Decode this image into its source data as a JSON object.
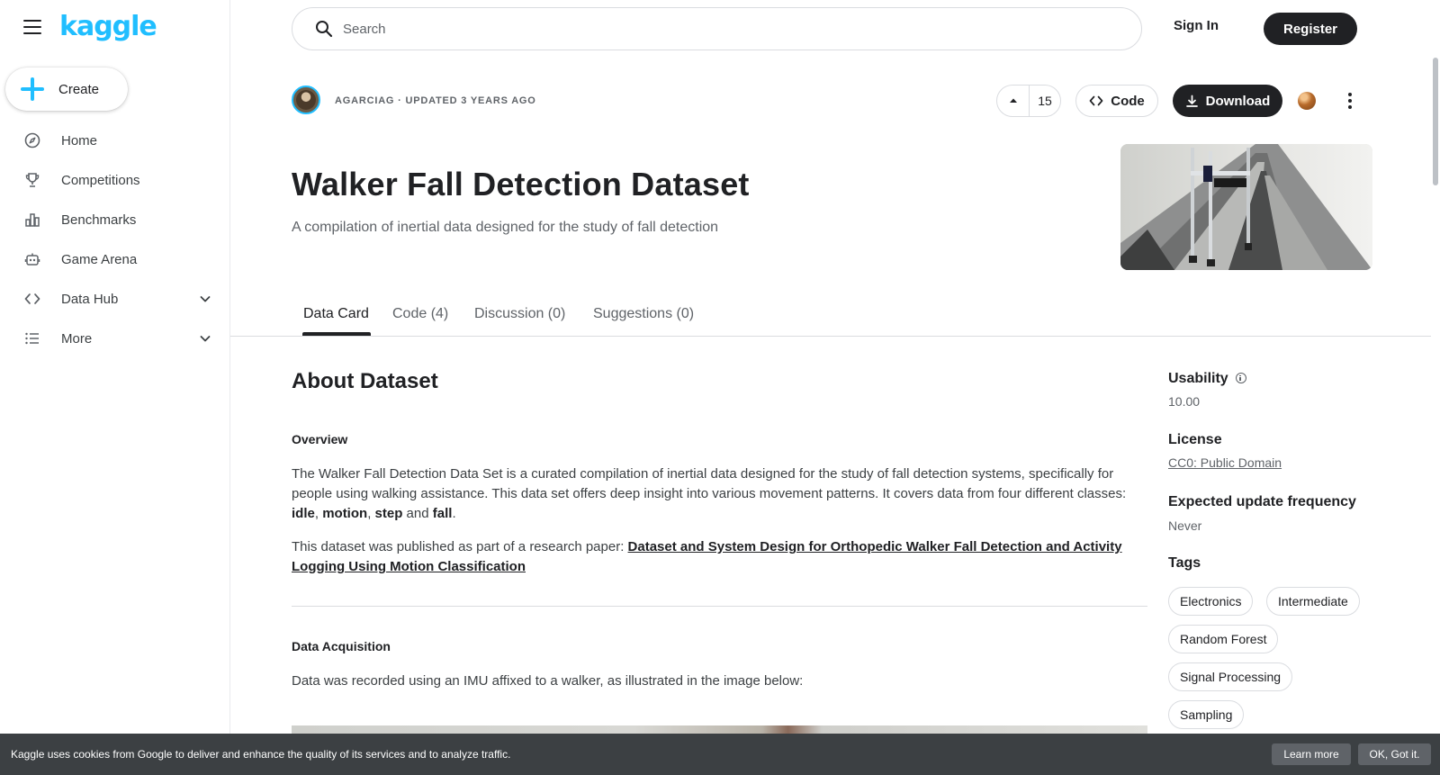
{
  "app": {
    "logo": "kaggle"
  },
  "sidebar": {
    "create_label": "Create",
    "items": [
      {
        "label": "Home",
        "icon": "compass-icon"
      },
      {
        "label": "Competitions",
        "icon": "trophy-icon"
      },
      {
        "label": "Benchmarks",
        "icon": "bar-chart-icon"
      },
      {
        "label": "Game Arena",
        "icon": "robot-icon"
      },
      {
        "label": "Data Hub",
        "icon": "code-brackets-icon"
      },
      {
        "label": "More",
        "icon": "list-icon"
      }
    ]
  },
  "topbar": {
    "search_placeholder": "Search",
    "signin_label": "Sign In",
    "register_label": "Register"
  },
  "dataset": {
    "byline": "AGARCIAG · UPDATED 3 YEARS AGO",
    "upvotes": "15",
    "code_label": "Code",
    "download_label": "Download",
    "title": "Walker Fall Detection Dataset",
    "subtitle": "A compilation of inertial data designed for the study of fall detection"
  },
  "tabs": [
    {
      "label": "Data Card"
    },
    {
      "label": "Code (4)"
    },
    {
      "label": "Discussion (0)"
    },
    {
      "label": "Suggestions (0)"
    }
  ],
  "content": {
    "about_heading": "About Dataset",
    "overview_heading": "Overview",
    "p1_text": "The Walker Fall Detection Data Set is a curated compilation of inertial data designed for the study of fall detection systems, specifically for people using walking assistance. This data set offers deep insight into various movement patterns. It covers data from four different classes: ",
    "classes": [
      "idle",
      "motion",
      "step",
      "fall"
    ],
    "p2_text": "This dataset was published as part of a research paper: ",
    "p2_link": "Dataset and System Design for Orthopedic Walker Fall Detection and Activity Logging Using Motion Classification",
    "acq_heading": "Data Acquisition",
    "acq_text": "Data was recorded using an IMU affixed to a walker, as illustrated in the image below:"
  },
  "meta": {
    "usability_label": "Usability",
    "usability_value": "10.00",
    "license_label": "License",
    "license_value": "CC0: Public Domain",
    "update_label": "Expected update frequency",
    "update_value": "Never",
    "tags_label": "Tags",
    "tags": [
      "Electronics",
      "Intermediate",
      "Random Forest",
      "Signal Processing",
      "Sampling"
    ]
  },
  "cookie": {
    "text": "Kaggle uses cookies from Google to deliver and enhance the quality of its services and to analyze traffic.",
    "learn_more": "Learn more",
    "ok": "OK, Got it."
  }
}
